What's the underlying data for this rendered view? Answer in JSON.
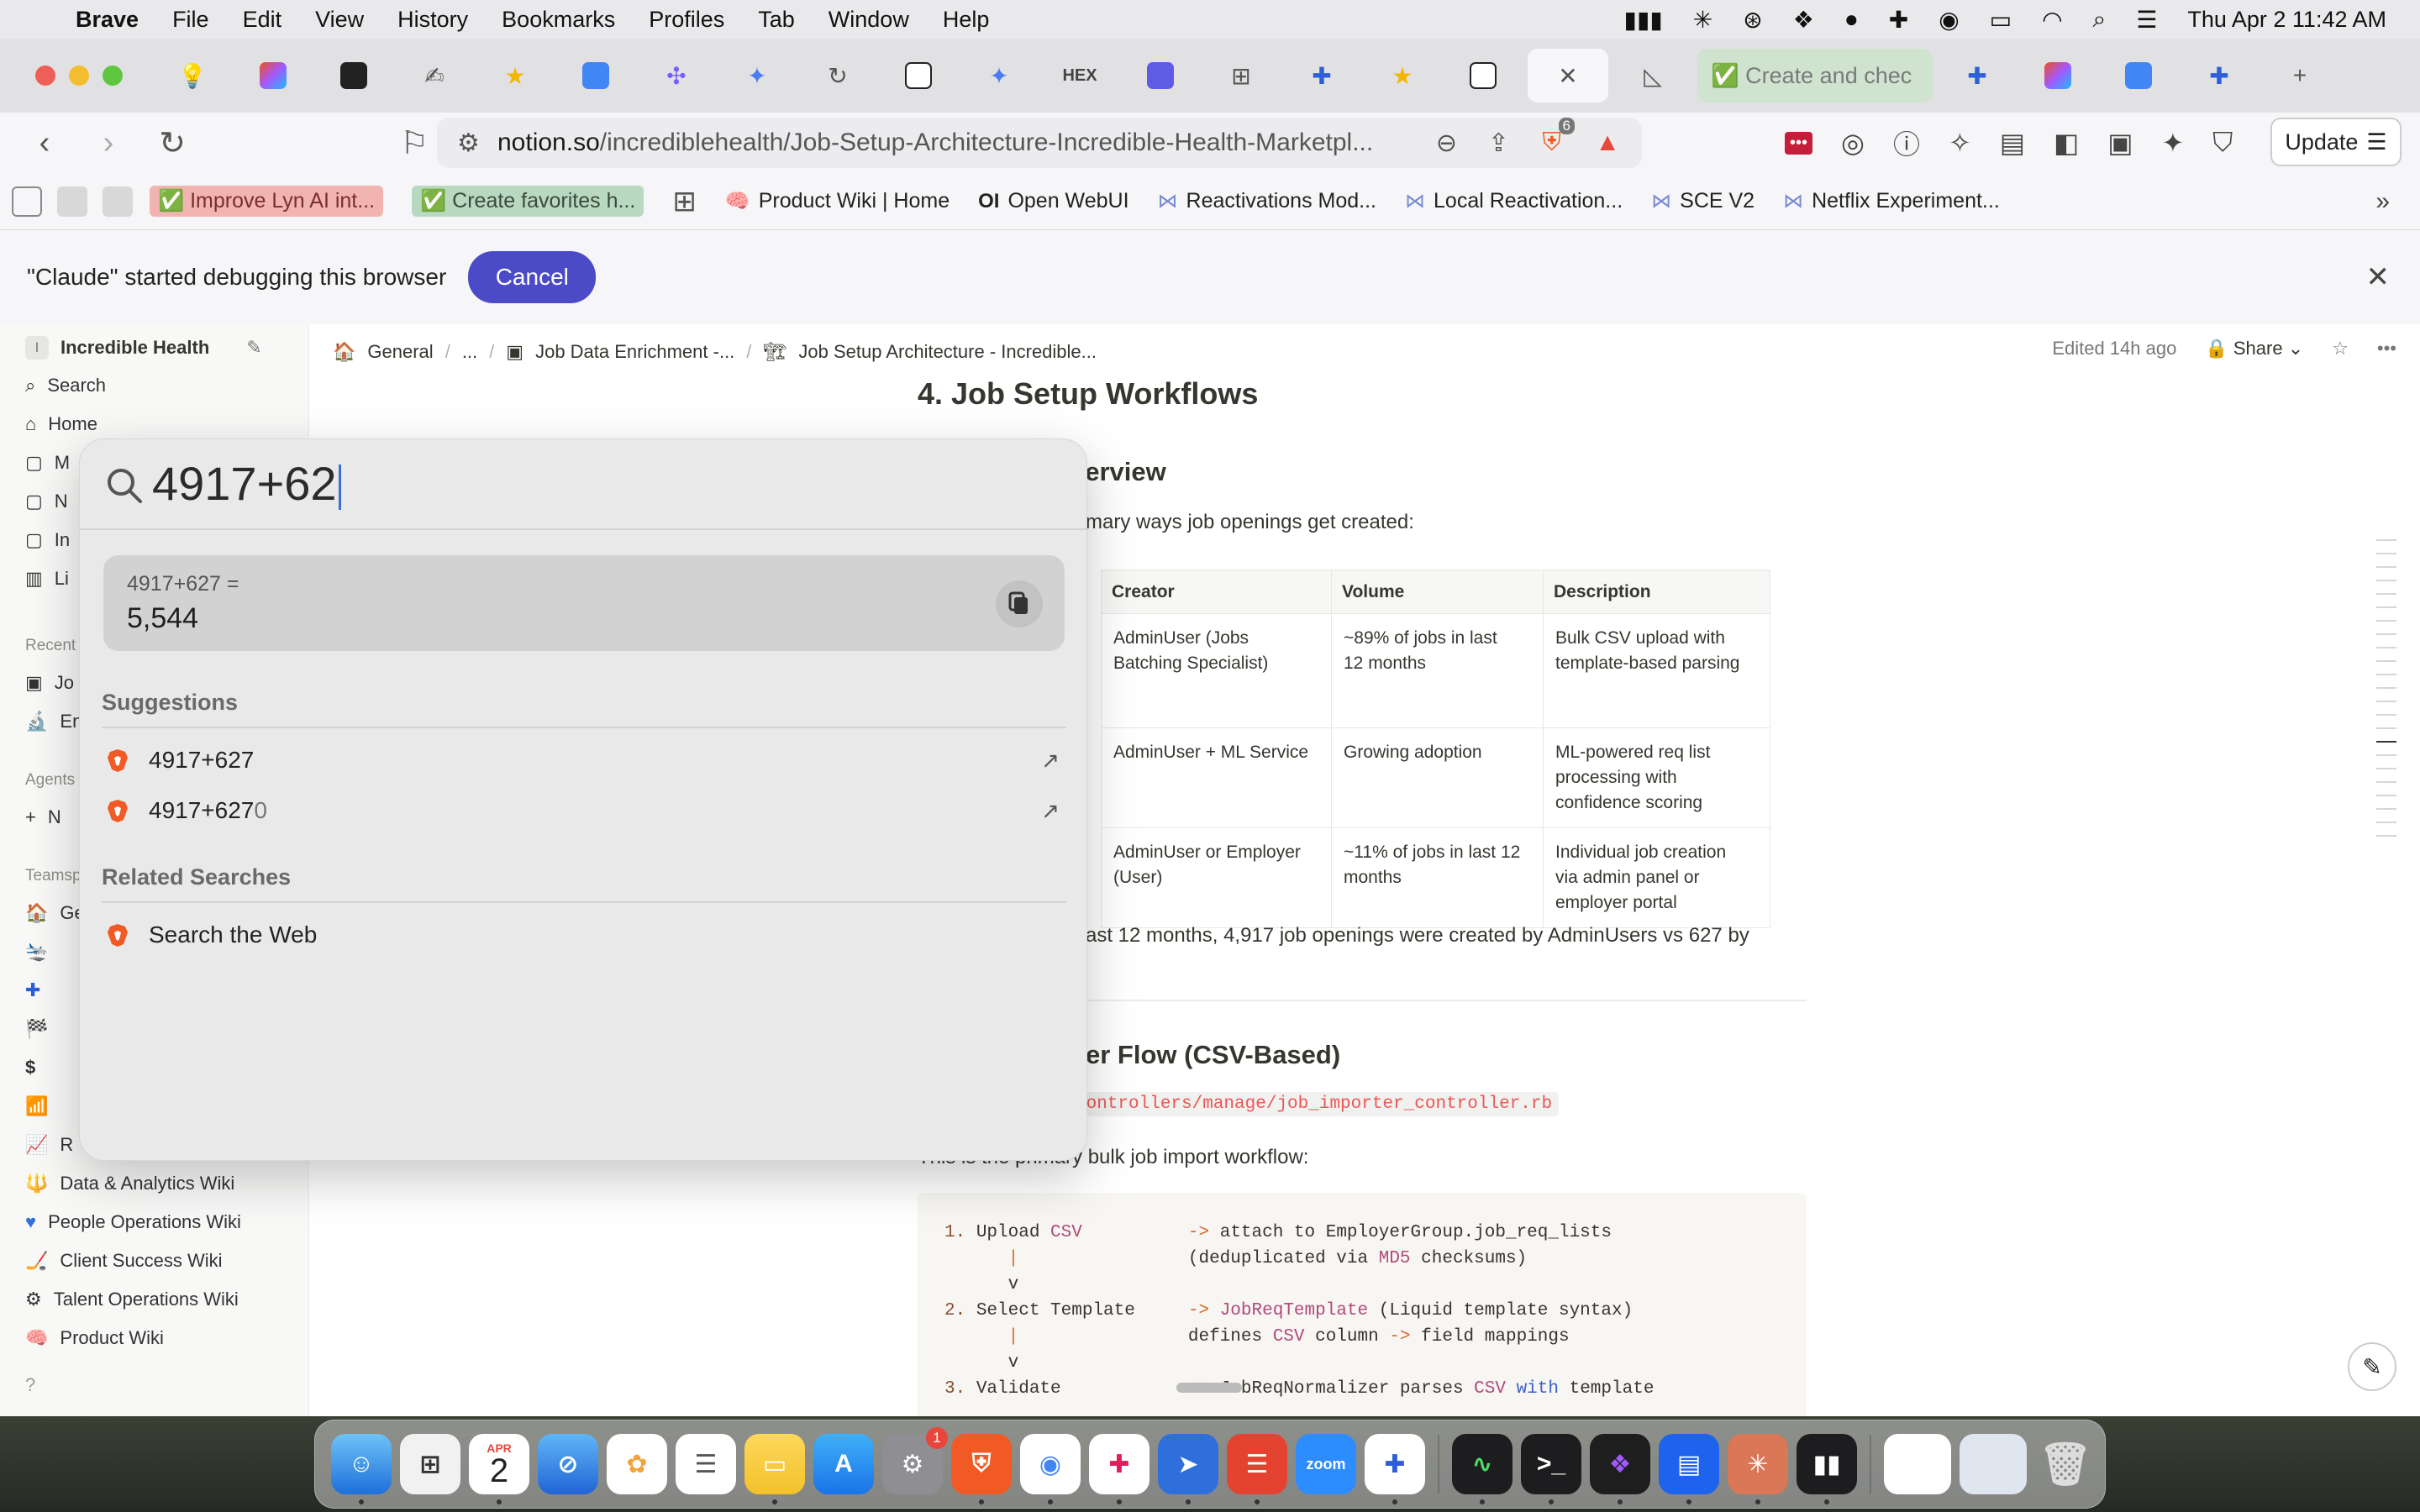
{
  "menubar": {
    "app_name": "Brave",
    "items": [
      "File",
      "Edit",
      "View",
      "History",
      "Bookmarks",
      "Profiles",
      "Tab",
      "Window",
      "Help"
    ],
    "clock": "Thu Apr 2  11:42 AM"
  },
  "tabs": {
    "highlight_tab_label": "✅ Create and chec",
    "close_symbol": "✕",
    "new_tab_symbol": "+"
  },
  "toolbar": {
    "url_host": "notion.so",
    "url_path": "/incrediblehealth/Job-Setup-Architecture-Incredible-Health-Marketpl...",
    "shield_count": "6",
    "update_label": "Update"
  },
  "bookmarks": [
    {
      "label": "✅ Improve Lyn AI int...",
      "style": "red"
    },
    {
      "label": "✅ Create favorites h...",
      "style": "green"
    },
    {
      "label": "Product Wiki | Home",
      "icon": "brain-icon"
    },
    {
      "label": "Open WebUI",
      "icon": "oi-icon"
    },
    {
      "label": "Reactivations Mod...",
      "icon": "link-icon"
    },
    {
      "label": "Local Reactivation...",
      "icon": "link-icon"
    },
    {
      "label": "SCE V2",
      "icon": "link-icon"
    },
    {
      "label": "Netflix Experiment...",
      "icon": "link-icon"
    }
  ],
  "debug_banner": {
    "message": "\"Claude\" started debugging this browser",
    "cancel_label": "Cancel"
  },
  "sidebar": {
    "workspace": "Incredible Health",
    "workspace_initial": "I",
    "search_label": "Search",
    "home_label": "Home",
    "partial_items": [
      "M",
      "N",
      "In",
      "Li"
    ],
    "recents_label": "Recent",
    "recent_partials": [
      "Jo",
      "En"
    ],
    "agents_label": "Agents",
    "agents_partial": "N",
    "teamspaces_label": "Teamsp",
    "team_partials": [
      "Ge",
      "",
      "",
      "",
      "",
      "",
      "R"
    ],
    "wikis": [
      "Data & Analytics Wiki",
      "People Operations Wiki",
      "Client Success Wiki",
      "Talent Operations Wiki",
      "Product Wiki"
    ]
  },
  "topbar": {
    "crumbs": [
      "General",
      "...",
      "Job Data Enrichment -...",
      "Job Setup Architecture - Incredible..."
    ],
    "edited": "Edited 14h ago",
    "share_label": "Share"
  },
  "doc": {
    "h1": "4. Job Setup Workflows",
    "h2_overview": "verview",
    "intro": "mary ways job openings get created:",
    "table": {
      "headers": [
        "Creator",
        "Volume",
        "Description"
      ],
      "rows": [
        [
          "AdminUser (Jobs\nBatching Specialist)",
          "~89% of jobs in last\n12 months",
          "Bulk CSV upload with\ntemplate-based parsing"
        ],
        [
          "AdminUser + ML Service",
          "Growing adoption",
          "ML-powered req list\nprocessing with\nconfidence scoring"
        ],
        [
          "AdminUser or Employer\n(User)",
          "~11% of jobs in last 12\nmonths",
          "Individual job creation\nvia admin panel or\nemployer portal"
        ]
      ]
    },
    "stat_line": "ast 12 months, 4,917 job openings were created by AdminUsers vs 627 by",
    "h2_flow": "er Flow (CSV-Based)",
    "code_path": "controllers/manage/job_importer_controller.rb",
    "flow_intro": "This is the primary bulk job import workflow:"
  },
  "spotlight": {
    "query": "4917+62",
    "result_equation": "4917+627 =",
    "result_value": "5,544",
    "suggestions_heading": "Suggestions",
    "suggestions": [
      "4917+627",
      "4917+627",
      "0"
    ],
    "related_heading": "Related Searches",
    "related": [
      "Search the Web"
    ]
  },
  "dock": {
    "calendar_month": "APR",
    "calendar_day": "2",
    "settings_badge": "1",
    "zoom_label": "zoom"
  }
}
